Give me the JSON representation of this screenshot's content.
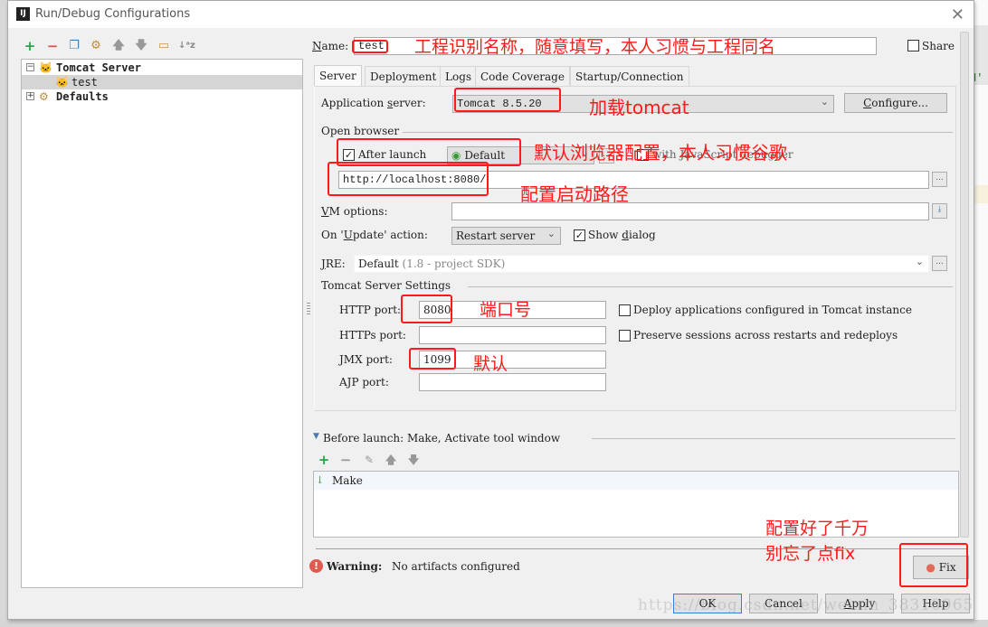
{
  "window": {
    "title": "Run/Debug Configurations",
    "app_icon": "IJ"
  },
  "left_toolbar": {
    "icons": [
      "add-icon",
      "remove-icon",
      "copy-icon",
      "wrench-icon",
      "move-up-icon",
      "move-down-icon",
      "folder-icon",
      "sort-alpha-icon"
    ]
  },
  "tree": {
    "items": [
      {
        "label": "Tomcat Server",
        "expanded": true,
        "bold": true
      },
      {
        "label": "test",
        "selected": true
      },
      {
        "label": "Defaults",
        "expanded": false,
        "bold": true
      }
    ]
  },
  "header": {
    "name_label": "Name:",
    "name_value": "test",
    "share_label": "Share",
    "share_checked": false
  },
  "tabs": [
    {
      "label": "Server",
      "active": true
    },
    {
      "label": "Deployment"
    },
    {
      "label": "Logs"
    },
    {
      "label": "Code Coverage"
    },
    {
      "label": "Startup/Connection"
    }
  ],
  "server": {
    "app_server_label": "Application server:",
    "app_server_value": "Tomcat 8.5.20",
    "configure_label": "Configure...",
    "open_browser_label": "Open browser",
    "after_launch_label": "After launch",
    "after_launch_checked": true,
    "browser_value": "Default",
    "js_debugger_label": "with JavaScript debugger",
    "js_debugger_checked": false,
    "url_value": "http://localhost:8080/",
    "vm_options_label": "VM options:",
    "vm_options_value": "",
    "on_update_label": "On 'Update' action:",
    "on_update_value": "Restart server",
    "show_dialog_label": "Show dialog",
    "show_dialog_checked": true,
    "jre_label": "JRE:",
    "jre_value": "Default",
    "jre_hint": "(1.8 - project SDK)",
    "tomcat_settings_label": "Tomcat Server Settings",
    "http_port_label": "HTTP port:",
    "http_port_value": "8080",
    "https_port_label": "HTTPs port:",
    "https_port_value": "",
    "jmx_port_label": "JMX port:",
    "jmx_port_value": "1099",
    "ajp_port_label": "AJP port:",
    "ajp_port_value": "",
    "deploy_apps_label": "Deploy applications configured in Tomcat instance",
    "deploy_apps_checked": false,
    "preserve_sessions_label": "Preserve sessions across restarts and redeploys",
    "preserve_sessions_checked": false,
    "ellipsis": "..."
  },
  "before_launch": {
    "header": "Before launch: Make, Activate tool window",
    "toolbar_icons": [
      "add-icon",
      "remove-icon",
      "edit-icon",
      "move-up-icon",
      "move-down-icon"
    ],
    "items": [
      {
        "label": "Make"
      }
    ]
  },
  "warning": {
    "prefix": "Warning:",
    "message": "No artifacts configured",
    "fix_label": "Fix"
  },
  "footer": {
    "ok_label": "OK",
    "cancel_label": "Cancel",
    "apply_label": "Apply",
    "help_label": "Help"
  },
  "annotations": {
    "name_note": "工程识别名称，随意填写，本人习惯与工程同名",
    "server_note": "加载tomcat",
    "browser_note": "默认浏览器配置，本人习惯谷歌",
    "url_note": "配置启动路径",
    "port_note": "端口号",
    "jmx_note": "默认",
    "fix_note_line1": "配置好了千万",
    "fix_note_line2": "别忘了点fix",
    "color": "#ff1a1a"
  },
  "watermark": "https://blog.csdn.net/weixin_38310965"
}
